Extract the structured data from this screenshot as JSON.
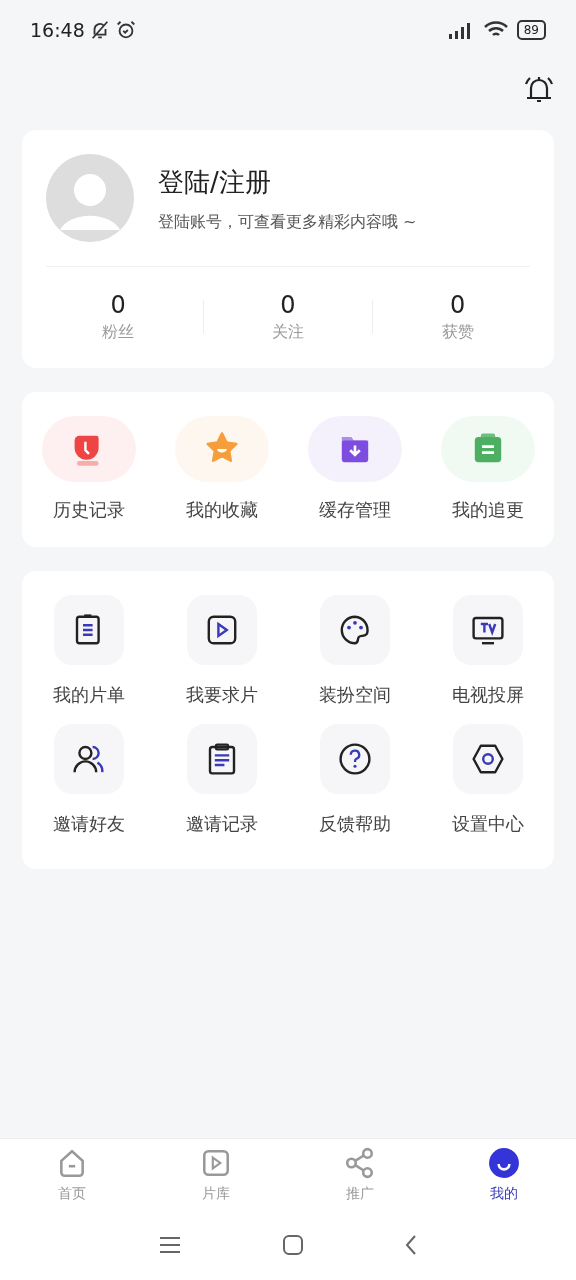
{
  "status_bar": {
    "time": "16:48",
    "battery": "89"
  },
  "profile": {
    "title": "登陆/注册",
    "subtitle": "登陆账号，可查看更多精彩内容哦 ~",
    "stats": [
      {
        "value": "0",
        "label": "粉丝"
      },
      {
        "value": "0",
        "label": "关注"
      },
      {
        "value": "0",
        "label": "获赞"
      }
    ]
  },
  "quick_items": [
    {
      "label": "历史记录",
      "color": "#ef4444"
    },
    {
      "label": "我的收藏",
      "color": "#f59e3b"
    },
    {
      "label": "缓存管理",
      "color": "#7c4ddf"
    },
    {
      "label": "我的追更",
      "color": "#4caf61"
    }
  ],
  "tools": [
    {
      "label": "我的片单"
    },
    {
      "label": "我要求片"
    },
    {
      "label": "装扮空间"
    },
    {
      "label": "电视投屏"
    },
    {
      "label": "邀请好友"
    },
    {
      "label": "邀请记录"
    },
    {
      "label": "反馈帮助"
    },
    {
      "label": "设置中心"
    }
  ],
  "tab_bar": [
    {
      "label": "首页",
      "selected": false
    },
    {
      "label": "片库",
      "selected": false
    },
    {
      "label": "推广",
      "selected": false
    },
    {
      "label": "我的",
      "selected": true
    }
  ]
}
